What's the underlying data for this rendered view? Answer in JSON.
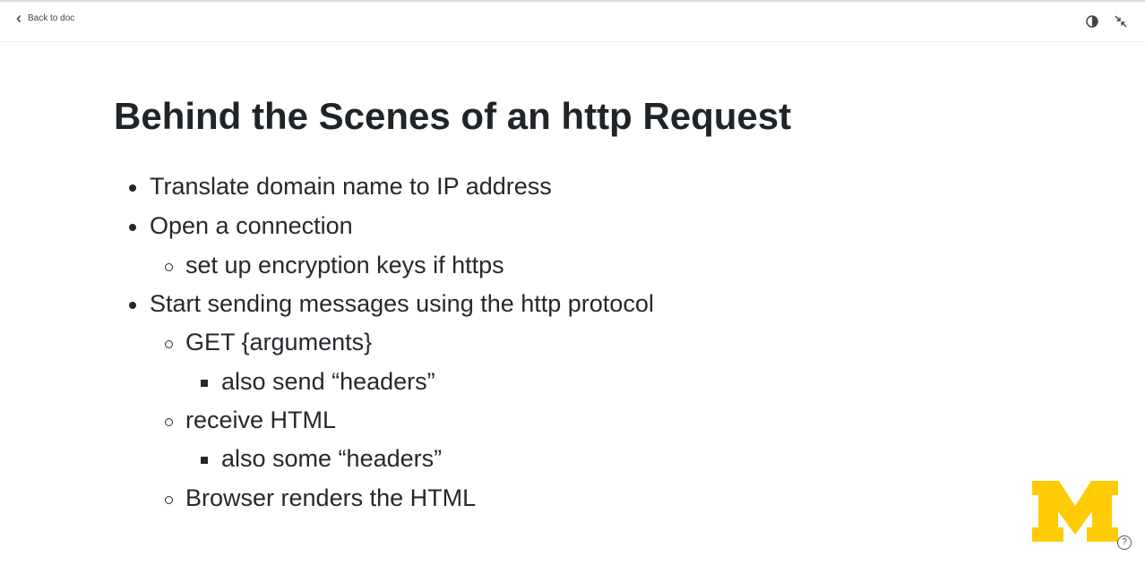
{
  "topbar": {
    "back_label": "Back to doc",
    "icons": [
      "chevron-left-icon",
      "contrast-icon",
      "collapse-icon"
    ]
  },
  "slide": {
    "title": "Behind the Scenes of an http Request",
    "bullets": [
      {
        "level": 1,
        "text": "Translate domain name to IP address"
      },
      {
        "level": 1,
        "text": "Open a connection"
      },
      {
        "level": 2,
        "text": "set up encryption keys if https"
      },
      {
        "level": 1,
        "text": "Start sending messages using the http protocol"
      },
      {
        "level": 2,
        "text": "GET {arguments}"
      },
      {
        "level": 3,
        "text": "also send “headers”"
      },
      {
        "level": 2,
        "text": "receive HTML"
      },
      {
        "level": 3,
        "text": "also some “headers”"
      },
      {
        "level": 2,
        "text": "Browser renders the HTML"
      }
    ]
  },
  "logo": {
    "name": "university-of-michigan-block-m",
    "text": "M",
    "color": "#FFCB05"
  },
  "help": {
    "label": "?"
  }
}
